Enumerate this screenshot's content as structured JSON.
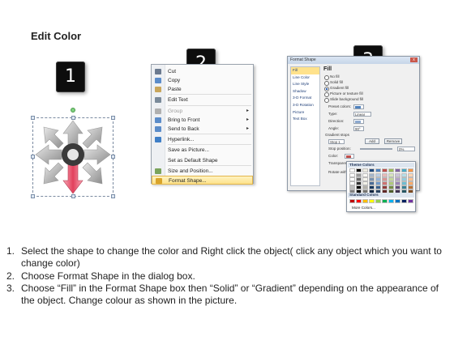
{
  "page": {
    "title": "Edit Color",
    "badges": [
      "1",
      "2",
      "3"
    ]
  },
  "context_menu": {
    "items": [
      {
        "label": "Cut",
        "icon": "scissors-icon",
        "disabled": false,
        "submenu": false
      },
      {
        "label": "Copy",
        "icon": "copy-icon",
        "disabled": false,
        "submenu": false
      },
      {
        "label": "Paste",
        "icon": "paste-icon",
        "disabled": false,
        "submenu": false
      },
      {
        "label": "Edit Text",
        "icon": "edit-text-icon",
        "disabled": false,
        "submenu": false
      },
      {
        "label": "Group",
        "icon": "group-icon",
        "disabled": true,
        "submenu": true
      },
      {
        "label": "Bring to Front",
        "icon": "bring-front-icon",
        "disabled": false,
        "submenu": true
      },
      {
        "label": "Send to Back",
        "icon": "send-back-icon",
        "disabled": false,
        "submenu": true
      },
      {
        "label": "Hyperlink...",
        "icon": "hyperlink-icon",
        "disabled": false,
        "submenu": false
      },
      {
        "label": "Save as Picture...",
        "icon": "",
        "disabled": false,
        "submenu": false
      },
      {
        "label": "Set as Default Shape",
        "icon": "",
        "disabled": false,
        "submenu": false
      },
      {
        "label": "Size and Position...",
        "icon": "size-icon",
        "disabled": false,
        "submenu": false
      },
      {
        "label": "Format Shape...",
        "icon": "format-shape-icon",
        "disabled": false,
        "submenu": false,
        "highlighted": true
      }
    ]
  },
  "format_dialog": {
    "title": "Format Shape",
    "close_label": "x",
    "sidebar": [
      "Fill",
      "Line Color",
      "Line Style",
      "Shadow",
      "3-D Format",
      "3-D Rotation",
      "Picture",
      "Text Box"
    ],
    "section_heading": "Fill",
    "fill_options": [
      "No fill",
      "Solid fill",
      "Gradient fill",
      "Picture or texture fill",
      "Slide background fill"
    ],
    "selected_fill": "Gradient fill",
    "preset_colors_label": "Preset colors:",
    "type_label": "Type:",
    "type_value": "Linear",
    "direction_label": "Direction:",
    "angle_label": "Angle:",
    "angle_value": "90°",
    "gradient_stops_label": "Gradient stops",
    "stop_value": "Stop 1",
    "add_label": "Add",
    "remove_label": "Remove",
    "stop_position_label": "Stop position:",
    "stop_position_value": "0%",
    "color_label": "Color:",
    "transparency_label": "Transparency:",
    "transparency_value": "0%",
    "rotate_label": "Rotate with shape",
    "close_button": "Close"
  },
  "palette": {
    "theme_label": "Theme Colors",
    "standard_label": "Standard Colors",
    "more_label": "More Colors...",
    "theme_top": [
      "#ffffff",
      "#000000",
      "#eeece1",
      "#1f497d",
      "#4f81bd",
      "#c0504d",
      "#9bbb59",
      "#8064a2",
      "#4bacc6",
      "#f79646"
    ],
    "standard": [
      "#c00000",
      "#ff0000",
      "#ffc000",
      "#ffff00",
      "#92d050",
      "#00b050",
      "#00b0f0",
      "#0070c0",
      "#002060",
      "#7030a0"
    ]
  },
  "instructions": [
    {
      "num": "1.",
      "text": "Select the shape to change the color and Right click the object( click any object which you want to change color)"
    },
    {
      "num": "2.",
      "text": "Choose Format Shape in the dialog box."
    },
    {
      "num": "3.",
      "text": "Choose “Fill” in the Format Shape box then “Solid” or “Gradient” depending on the appearance of the object. Change colour as shown in the picture."
    }
  ]
}
